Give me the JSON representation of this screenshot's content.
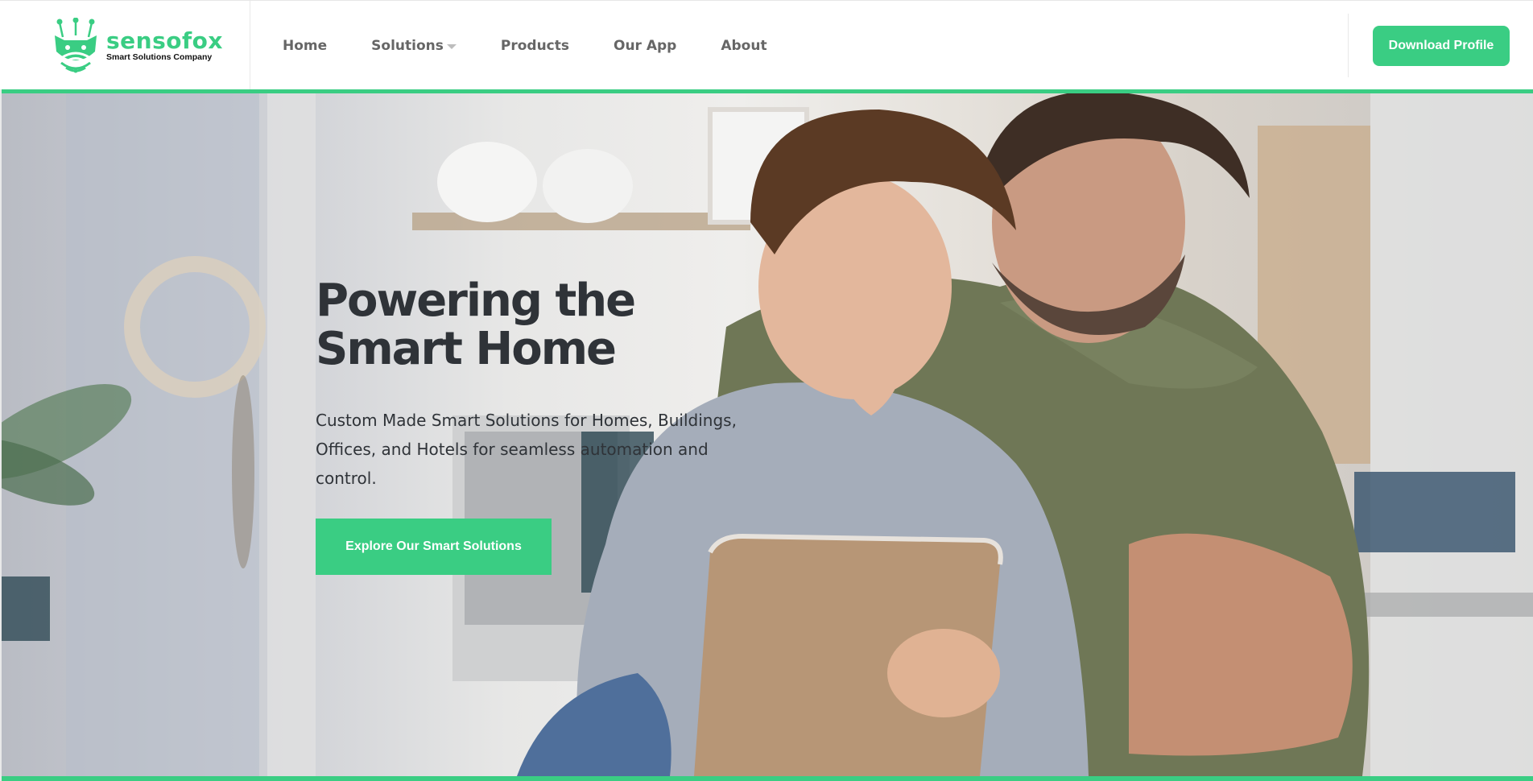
{
  "colors": {
    "accent": "#3acd83",
    "text_dark": "#2f3338",
    "nav_text": "#666666"
  },
  "logo": {
    "name": "sensofox",
    "tagline": "Smart Solutions Company",
    "icon": "fox-wifi-logo-icon"
  },
  "nav": {
    "items": [
      {
        "label": "Home"
      },
      {
        "label": "Solutions",
        "icon": "chevron-down-icon"
      },
      {
        "label": "Products"
      },
      {
        "label": "Our App"
      },
      {
        "label": "About"
      }
    ],
    "download_label": "Download Profile"
  },
  "hero": {
    "title": "Powering the Smart Home",
    "subtitle": "Custom Made Smart Solutions for Homes, Buildings, Offices, and Hotels for seamless automation and control.",
    "cta_label": "Explore Our Smart Solutions",
    "image": "father-and-son-with-tablet-photo"
  }
}
